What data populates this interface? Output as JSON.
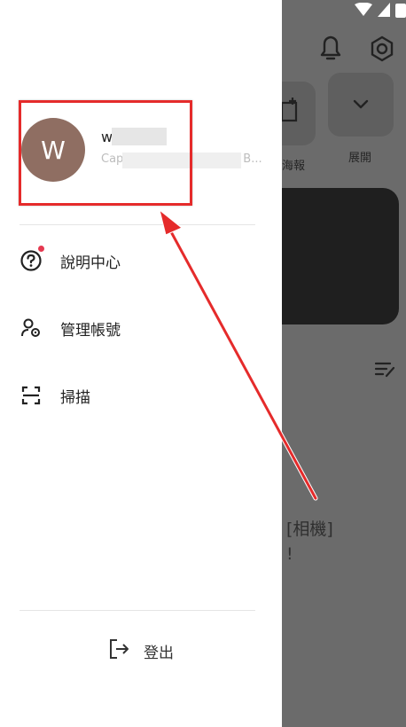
{
  "background": {
    "tile_label_poster": "海報",
    "tile_label_expand": "展開",
    "text_camera": "[相機]",
    "text_exclaim": "!"
  },
  "drawer": {
    "avatar_letter": "W",
    "user_name": "wl",
    "user_subtitle": "Cap",
    "user_subtitle_tail": "B...",
    "menu": [
      {
        "label": "說明中心",
        "icon": "help-circle-icon"
      },
      {
        "label": "管理帳號",
        "icon": "user-settings-icon"
      },
      {
        "label": "掃描",
        "icon": "scan-icon"
      }
    ],
    "logout_label": "登出"
  },
  "colors": {
    "highlight": "#e52b2b",
    "avatar": "#8f6e62",
    "badge_dot": "#e53950"
  }
}
